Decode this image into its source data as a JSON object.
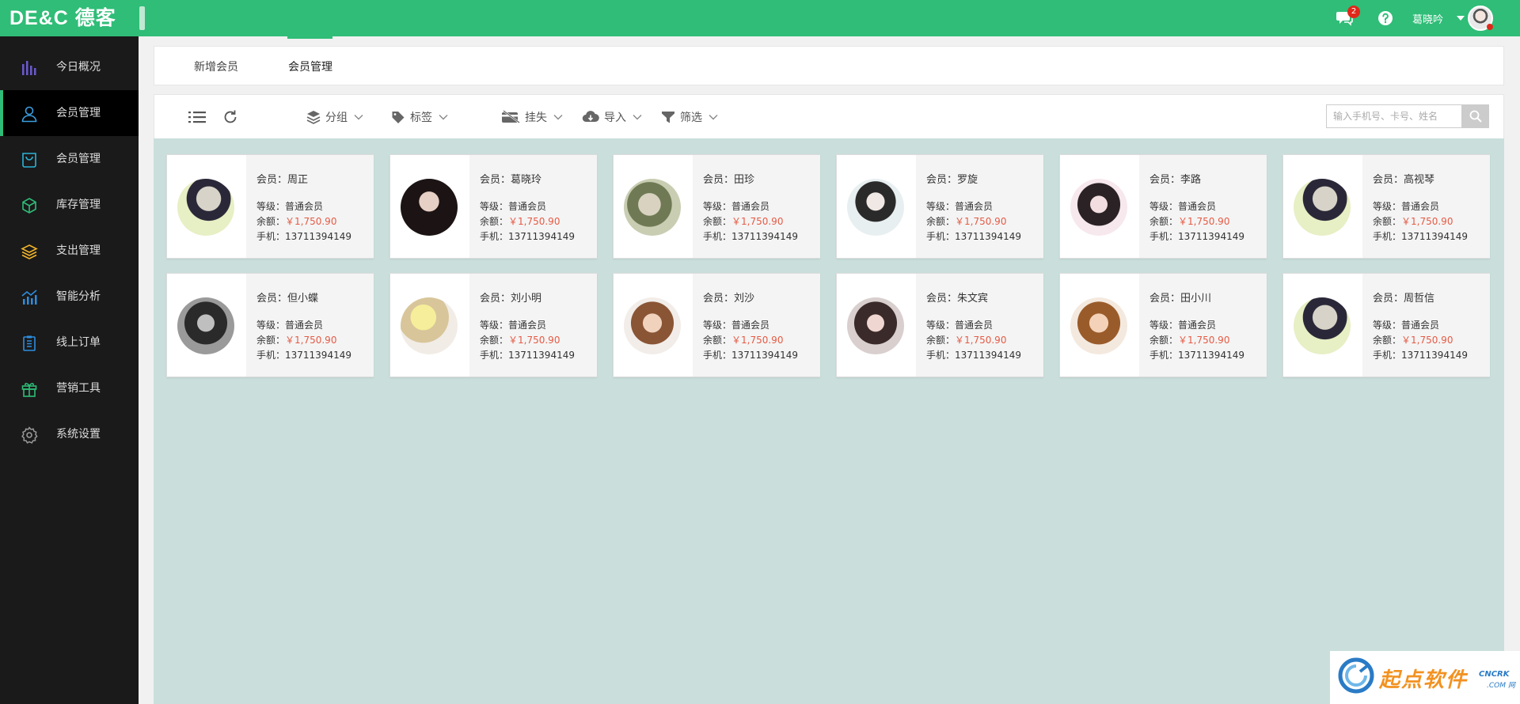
{
  "app": {
    "logo_text": "DE&C 德客",
    "accent_color": "#2fbd77"
  },
  "header": {
    "message_icon": "chat-icon",
    "message_count": "2",
    "help_icon": "question-icon",
    "user_name": "葛晓吟"
  },
  "sidebar": {
    "items": [
      {
        "label": "今日概况",
        "icon": "bar-chart-icon",
        "color": "#6a5acd"
      },
      {
        "label": "会员管理",
        "icon": "user-icon",
        "color": "#3b9ee0",
        "active": true
      },
      {
        "label": "会员管理",
        "icon": "bag-icon",
        "color": "#2bb3d6"
      },
      {
        "label": "库存管理",
        "icon": "cube-icon",
        "color": "#2fbd77"
      },
      {
        "label": "支出管理",
        "icon": "layers-icon",
        "color": "#f1b32a"
      },
      {
        "label": "智能分析",
        "icon": "trend-chart-icon",
        "color": "#2d8ee0"
      },
      {
        "label": "线上订单",
        "icon": "clipboard-icon",
        "color": "#2d8ee0"
      },
      {
        "label": "营销工具",
        "icon": "gift-icon",
        "color": "#2fbd77"
      },
      {
        "label": "系统设置",
        "icon": "gear-icon",
        "color": "#999999"
      }
    ]
  },
  "tabs": [
    {
      "label": "新增会员"
    },
    {
      "label": "会员管理",
      "active": true
    }
  ],
  "toolbar": {
    "group_label": "分组",
    "tag_label": "标签",
    "lost_label": "挂失",
    "import_label": "导入",
    "filter_label": "筛选",
    "search_placeholder": "输入手机号、卡号、姓名"
  },
  "members": [
    {
      "name": "会员：周正",
      "level": "等级：普通会员",
      "balance_label": "余额：",
      "balance": "￥1,750.90",
      "phone": "手机：13711394149"
    },
    {
      "name": "会员：葛晓玲",
      "level": "等级：普通会员",
      "balance_label": "余额：",
      "balance": "￥1,750.90",
      "phone": "手机：13711394149"
    },
    {
      "name": "会员：田珍",
      "level": "等级：普通会员",
      "balance_label": "余额：",
      "balance": "￥1,750.90",
      "phone": "手机：13711394149"
    },
    {
      "name": "会员：罗旋",
      "level": "等级：普通会员",
      "balance_label": "余额：",
      "balance": "￥1,750.90",
      "phone": "手机：13711394149"
    },
    {
      "name": "会员：李路",
      "level": "等级：普通会员",
      "balance_label": "余额：",
      "balance": "￥1,750.90",
      "phone": "手机：13711394149"
    },
    {
      "name": "会员：高视琴",
      "level": "等级：普通会员",
      "balance_label": "余额：",
      "balance": "￥1,750.90",
      "phone": "手机：13711394149"
    },
    {
      "name": "会员：但小蝶",
      "level": "等级：普通会员",
      "balance_label": "余额：",
      "balance": "￥1,750.90",
      "phone": "手机：13711394149"
    },
    {
      "name": "会员：刘小明",
      "level": "等级：普通会员",
      "balance_label": "余额：",
      "balance": "￥1,750.90",
      "phone": "手机：13711394149"
    },
    {
      "name": "会员：刘沙",
      "level": "等级：普通会员",
      "balance_label": "余额：",
      "balance": "￥1,750.90",
      "phone": "手机：13711394149"
    },
    {
      "name": "会员：朱文宾",
      "level": "等级：普通会员",
      "balance_label": "余额：",
      "balance": "￥1,750.90",
      "phone": "手机：13711394149"
    },
    {
      "name": "会员：田小川",
      "level": "等级：普通会员",
      "balance_label": "余额：",
      "balance": "￥1,750.90",
      "phone": "手机：13711394149"
    },
    {
      "name": "会员：周哲信",
      "level": "等级：普通会员",
      "balance_label": "余额：",
      "balance": "￥1,750.90",
      "phone": "手机：13711394149"
    }
  ],
  "watermark": {
    "text": "起点软件",
    "sub1": "CNCRK",
    "sub2": ".COM 网"
  }
}
